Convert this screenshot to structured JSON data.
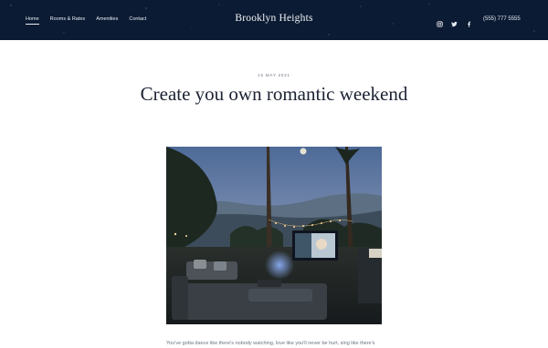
{
  "header": {
    "nav": [
      {
        "label": "Home",
        "active": true
      },
      {
        "label": "Rooms & Rates"
      },
      {
        "label": "Amenities"
      },
      {
        "label": "Contact"
      }
    ],
    "brand": "Brooklyn Heights",
    "social": [
      "instagram-icon",
      "twitter-icon",
      "facebook-icon"
    ],
    "phone": "(555) 777 5555",
    "colors": {
      "background": "#0b1b33",
      "text": "#e9edf5"
    }
  },
  "post": {
    "date": "15 MAY 2021",
    "title": "Create you own romantic weekend",
    "image": "Outdoor movie night in a backyard with palm trees, string lights and a projector screen at dusk",
    "excerpt": "You've gotta dance like there's nobody watching, love like you'll never be hurt, sing like there's"
  }
}
